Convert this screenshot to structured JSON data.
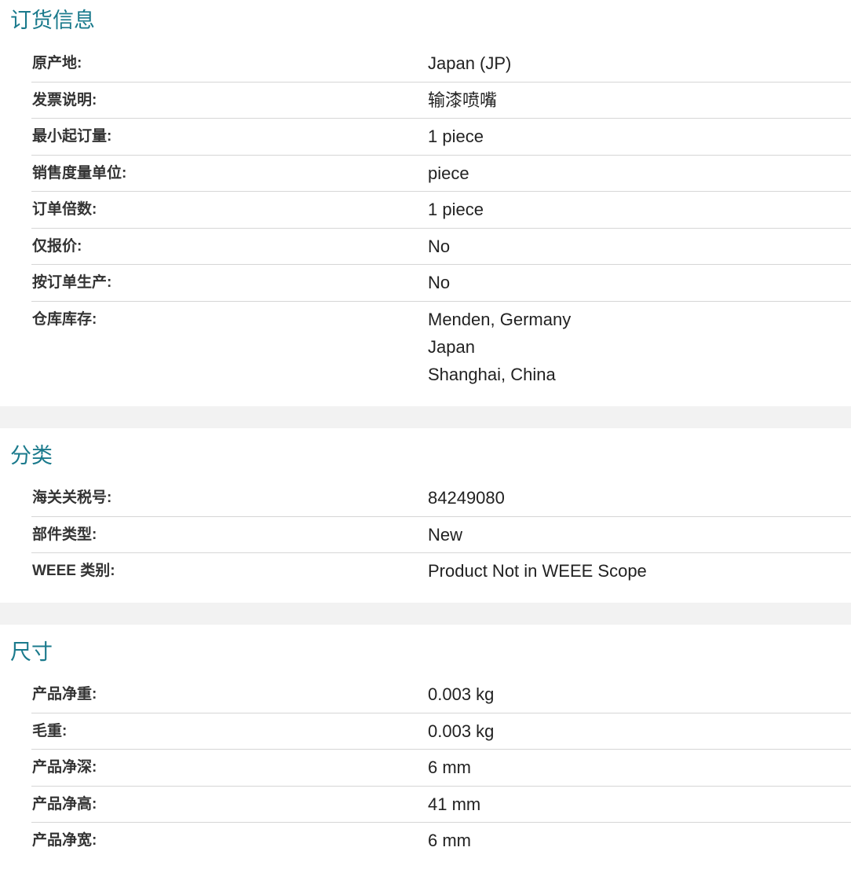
{
  "sections": [
    {
      "title": "订货信息",
      "rows": [
        {
          "label": "原产地:",
          "value": "Japan (JP)"
        },
        {
          "label": "发票说明:",
          "value": "输漆喷嘴"
        },
        {
          "label": "最小起订量:",
          "value": "1 piece"
        },
        {
          "label": "销售度量单位:",
          "value": "piece"
        },
        {
          "label": "订单倍数:",
          "value": "1 piece"
        },
        {
          "label": "仅报价:",
          "value": "No"
        },
        {
          "label": "按订单生产:",
          "value": "No"
        },
        {
          "label": "仓库库存:",
          "values": [
            "Menden, Germany",
            "Japan",
            "Shanghai, China"
          ]
        }
      ]
    },
    {
      "title": "分类",
      "rows": [
        {
          "label": "海关关税号:",
          "value": "84249080"
        },
        {
          "label": "部件类型:",
          "value": "New"
        },
        {
          "label": "WEEE 类别:",
          "value": "Product Not in WEEE Scope"
        }
      ]
    },
    {
      "title": "尺寸",
      "rows": [
        {
          "label": "产品净重:",
          "value": "0.003 kg"
        },
        {
          "label": "毛重:",
          "value": "0.003 kg"
        },
        {
          "label": "产品净深:",
          "value": "6 mm"
        },
        {
          "label": "产品净高:",
          "value": "41 mm"
        },
        {
          "label": "产品净宽:",
          "value": "6 mm"
        }
      ]
    }
  ]
}
